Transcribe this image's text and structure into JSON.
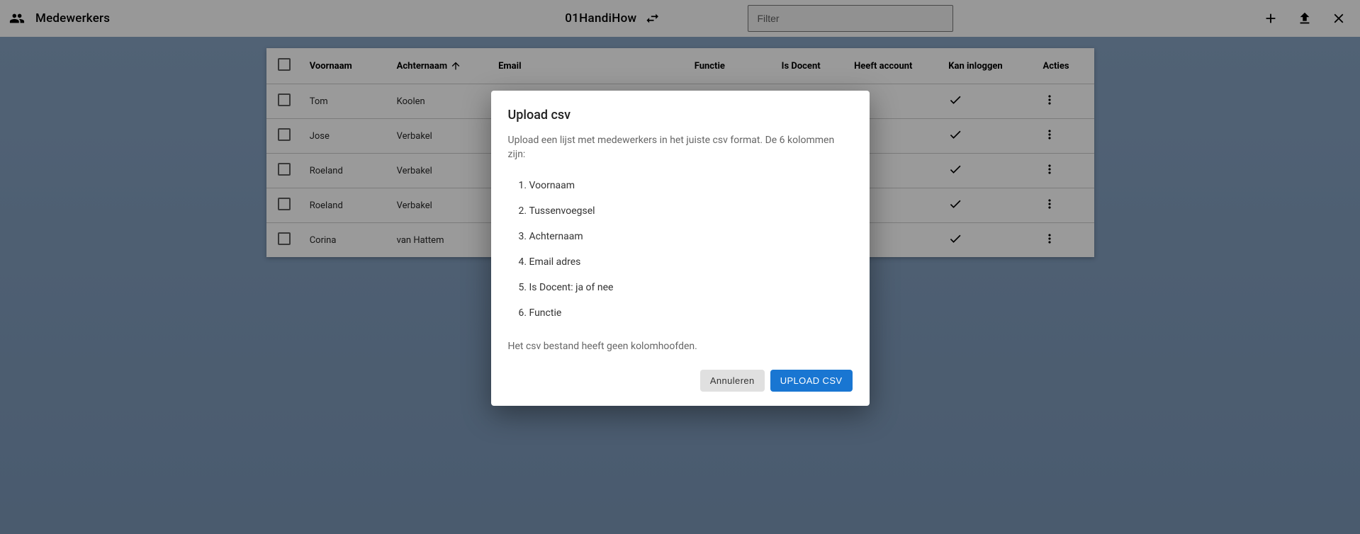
{
  "toolbar": {
    "title": "Medewerkers",
    "org": "01HandiHow",
    "filter_placeholder": "Filter"
  },
  "table": {
    "headers": {
      "voornaam": "Voornaam",
      "achternaam": "Achternaam",
      "email": "Email",
      "functie": "Functie",
      "is_docent": "Is Docent",
      "heeft_account": "Heeft account",
      "kan_inloggen": "Kan inloggen",
      "acties": "Acties"
    },
    "rows": [
      {
        "voornaam": "Tom",
        "achternaam": "Koolen"
      },
      {
        "voornaam": "Jose",
        "achternaam": "Verbakel"
      },
      {
        "voornaam": "Roeland",
        "achternaam": "Verbakel"
      },
      {
        "voornaam": "Roeland",
        "achternaam": "Verbakel"
      },
      {
        "voornaam": "Corina",
        "achternaam": "van Hattem"
      }
    ]
  },
  "dialog": {
    "title": "Upload csv",
    "intro": "Upload een lijst met medewerkers in het juiste csv format. De 6 kolommen zijn:",
    "columns": [
      "Voornaam",
      "Tussenvoegsel",
      "Achternaam",
      "Email adres",
      "Is Docent: ja of nee",
      "Functie"
    ],
    "note": "Het csv bestand heeft geen kolomhoofden.",
    "cancel": "Annuleren",
    "upload": "UPLOAD CSV"
  }
}
